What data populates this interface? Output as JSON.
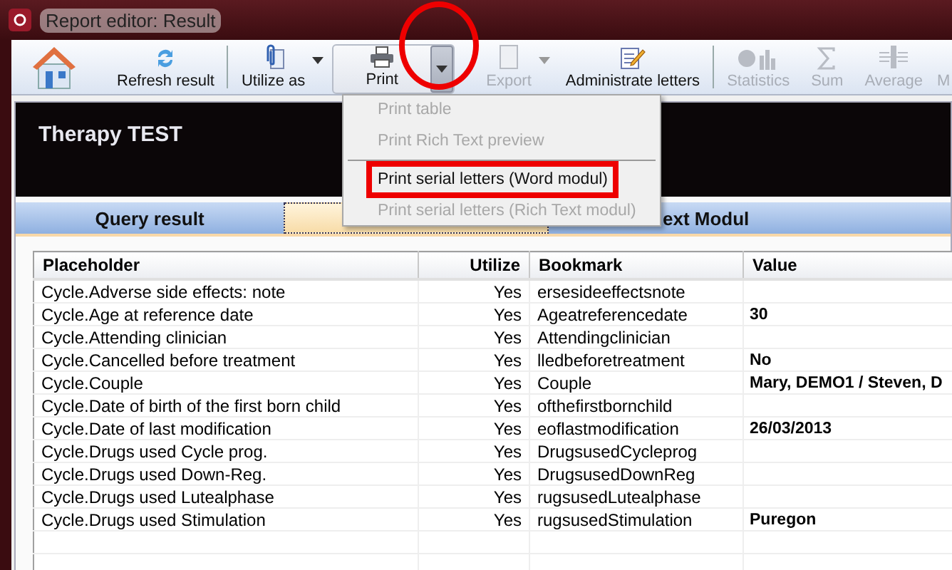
{
  "window": {
    "title": "Report editor: Result"
  },
  "toolbar": {
    "items": [
      {
        "kind": "home"
      },
      {
        "kind": "refresh",
        "label": "Refresh result",
        "disabled": false,
        "dropdown": false
      },
      {
        "kind": "separator"
      },
      {
        "kind": "utilize",
        "label": "Utilize as",
        "disabled": false,
        "dropdown": true
      },
      {
        "kind": "print",
        "label": "Print",
        "disabled": false,
        "pressed": true,
        "circled": true
      },
      {
        "kind": "export",
        "label": "Export",
        "disabled": true,
        "dropdown": true
      },
      {
        "kind": "letters",
        "label": "Administrate letters",
        "disabled": false,
        "dropdown": false
      },
      {
        "kind": "separator"
      },
      {
        "kind": "statistics",
        "label": "Statistics",
        "disabled": true,
        "dropdown": false
      },
      {
        "kind": "sum",
        "label": "Sum",
        "disabled": true,
        "dropdown": false
      },
      {
        "kind": "average",
        "label": "Average",
        "disabled": true,
        "dropdown": false
      },
      {
        "kind": "other",
        "label": "M",
        "disabled": true,
        "dropdown": false
      }
    ]
  },
  "menu": {
    "items": [
      {
        "kind": "item",
        "label": "Print table",
        "disabled": true,
        "highlighted": false
      },
      {
        "kind": "item",
        "label": "Print Rich Text preview",
        "disabled": true,
        "highlighted": false
      },
      {
        "kind": "separator"
      },
      {
        "kind": "item",
        "label": "Print serial letters (Word modul)",
        "disabled": false,
        "highlighted": true
      },
      {
        "kind": "item",
        "label": "Print serial letters (Rich Text modul)",
        "disabled": true,
        "highlighted": false
      }
    ]
  },
  "header": {
    "title": "Therapy TEST"
  },
  "tabs": [
    {
      "label": "Query result",
      "selected": false
    },
    {
      "selected": true
    },
    {
      "label": "ext Modul",
      "selected": false
    }
  ],
  "table": {
    "columns": [
      "Placeholder",
      "Utilize",
      "Bookmark",
      "Value"
    ],
    "rows": [
      {
        "placeholder": "Cycle.Adverse side effects: note",
        "utilize": "Yes",
        "bookmark": "ersesideeffectsnote"
      },
      {
        "placeholder": "Cycle.Age at reference date",
        "utilize": "Yes",
        "bookmark": "Ageatreferencedate",
        "value": "30"
      },
      {
        "placeholder": "Cycle.Attending clinician",
        "utilize": "Yes",
        "bookmark": "Attendingclinician"
      },
      {
        "placeholder": "Cycle.Cancelled before treatment",
        "utilize": "Yes",
        "bookmark": "lledbeforetreatment",
        "value": "No"
      },
      {
        "placeholder": "Cycle.Couple",
        "utilize": "Yes",
        "bookmark": "Couple",
        "value": "Mary, DEMO1 / Steven, D"
      },
      {
        "placeholder": "Cycle.Date of birth of the first born child",
        "utilize": "Yes",
        "bookmark": "ofthefirstbornchild"
      },
      {
        "placeholder": "Cycle.Date of last modification",
        "utilize": "Yes",
        "bookmark": "eoflastmodification",
        "value": "26/03/2013"
      },
      {
        "placeholder": "Cycle.Drugs used Cycle prog.",
        "utilize": "Yes",
        "bookmark": "DrugsusedCycleprog"
      },
      {
        "placeholder": "Cycle.Drugs used Down-Reg.",
        "utilize": "Yes",
        "bookmark": "DrugsusedDownReg"
      },
      {
        "placeholder": "Cycle.Drugs used Lutealphase",
        "utilize": "Yes",
        "bookmark": "rugsusedLutealphase"
      },
      {
        "placeholder": "Cycle.Drugs used Stimulation",
        "utilize": "Yes",
        "bookmark": "rugsusedStimulation",
        "value": "Puregon"
      }
    ]
  }
}
